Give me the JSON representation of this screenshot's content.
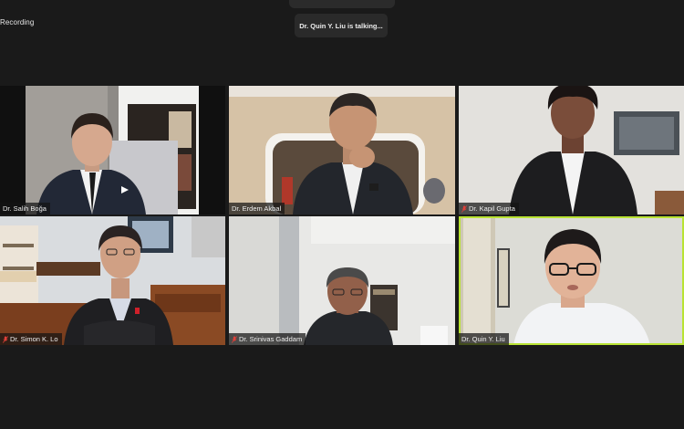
{
  "meeting": {
    "recording_label": "Recording",
    "talking_indicator": "Dr. Quin Y. Liu is talking..."
  },
  "participants": [
    {
      "name": "Dr. Salih Boğa",
      "muted": false,
      "active": false
    },
    {
      "name": "Dr. Erdem Akbal",
      "muted": false,
      "active": false
    },
    {
      "name": "Dr. Kapil Gupta",
      "muted": true,
      "active": false
    },
    {
      "name": "Dr. Simon K. Lo",
      "muted": true,
      "active": false
    },
    {
      "name": "Dr. Srinivas Gaddam",
      "muted": true,
      "active": false
    },
    {
      "name": "Dr. Quin Y. Liu",
      "muted": false,
      "active": true
    }
  ],
  "colors": {
    "background": "#1a1a1a",
    "active_speaker_border": "#b9e334",
    "muted_icon": "#e0413a"
  },
  "icons": {
    "muted": "microphone-muted-icon"
  }
}
